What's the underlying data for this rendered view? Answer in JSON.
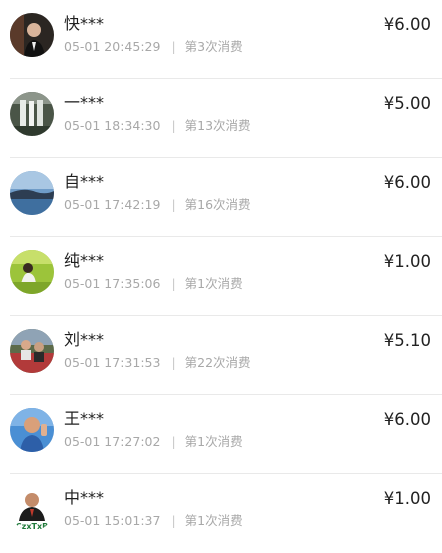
{
  "currency_symbol": "¥",
  "separator": "|",
  "records": [
    {
      "name": "快***",
      "time": "05-01 20:45:29",
      "count": "第3次消费",
      "amount": "6.00",
      "avatar": "man-portrait-dark-avatar"
    },
    {
      "name": "一***",
      "time": "05-01 18:34:30",
      "count": "第13次消费",
      "amount": "5.00",
      "avatar": "waterfall-avatar"
    },
    {
      "name": "自***",
      "time": "05-01 17:42:19",
      "count": "第16次消费",
      "amount": "6.00",
      "avatar": "lake-landscape-avatar"
    },
    {
      "name": "纯***",
      "time": "05-01 17:35:06",
      "count": "第1次消费",
      "amount": "1.00",
      "avatar": "person-in-field-avatar"
    },
    {
      "name": "刘***",
      "time": "05-01 17:31:53",
      "count": "第22次消费",
      "amount": "5.10",
      "avatar": "people-outdoor-avatar"
    },
    {
      "name": "王***",
      "time": "05-01 17:27:02",
      "count": "第1次消费",
      "amount": "6.00",
      "avatar": "man-waving-avatar"
    },
    {
      "name": "中***",
      "time": "05-01 15:01:37",
      "count": "第1次消费",
      "amount": "1.00",
      "avatar": "man-logo-avatar",
      "avatar_text": "CzxTxB"
    }
  ]
}
